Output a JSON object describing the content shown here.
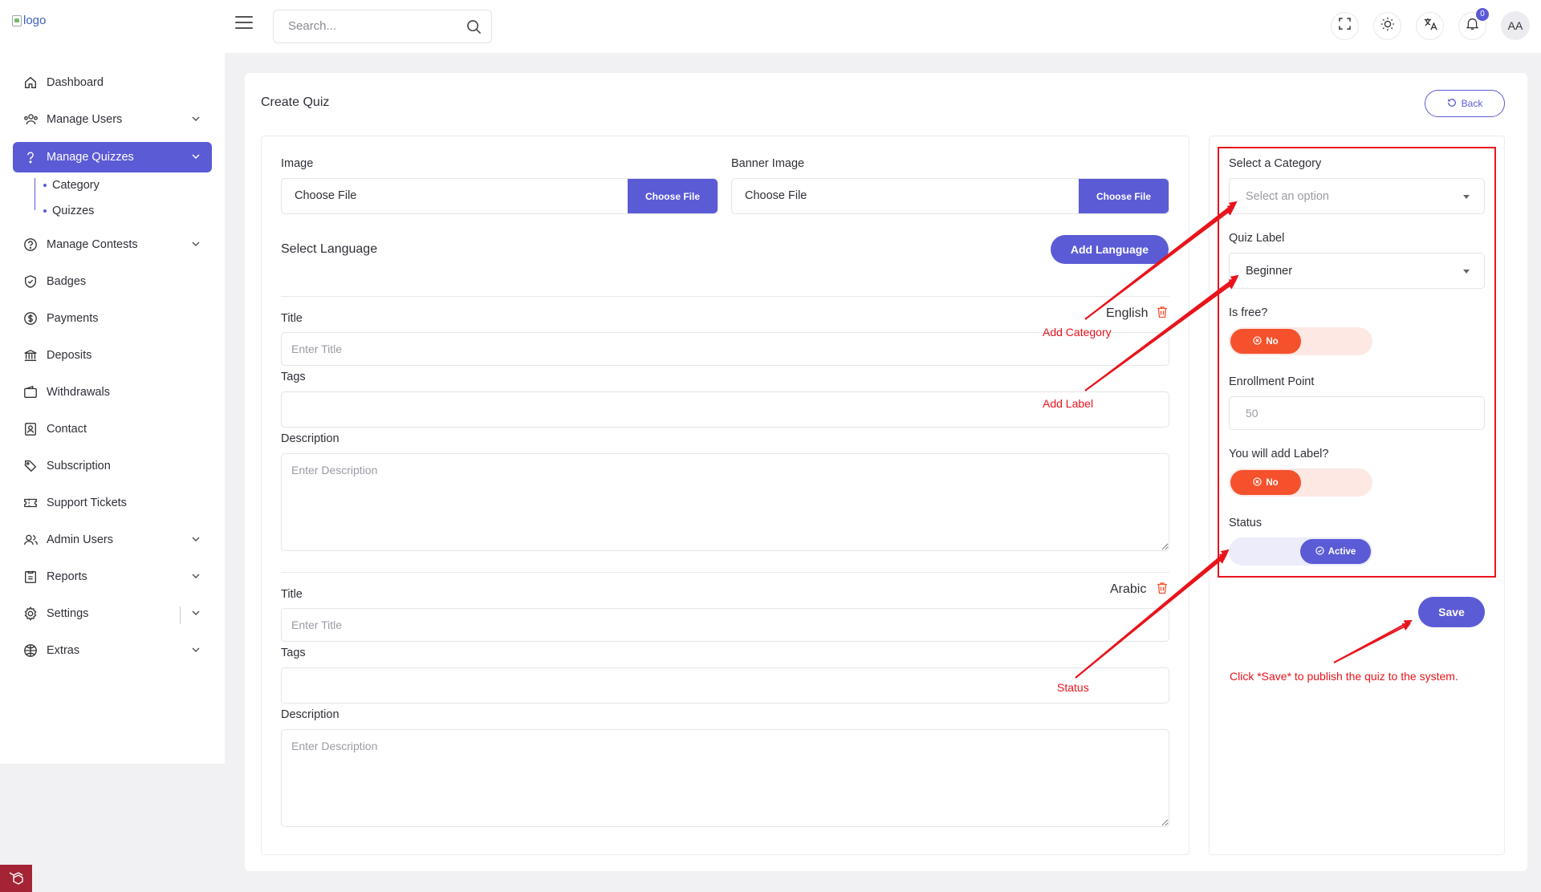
{
  "header": {
    "logo_alt": "logo",
    "search_placeholder": "Search...",
    "notification_count": "0",
    "avatar_initials": "AA"
  },
  "sidebar": {
    "items": [
      {
        "label": "Dashboard",
        "icon": "home-icon"
      },
      {
        "label": "Manage Users",
        "icon": "users-icon"
      },
      {
        "label": "Manage Quizzes",
        "icon": "question-icon"
      },
      {
        "label": "Manage Contests",
        "icon": "contest-icon"
      },
      {
        "label": "Badges",
        "icon": "shield-check-icon"
      },
      {
        "label": "Payments",
        "icon": "dollar-icon"
      },
      {
        "label": "Deposits",
        "icon": "bank-icon"
      },
      {
        "label": "Withdrawals",
        "icon": "wallet-icon"
      },
      {
        "label": "Contact",
        "icon": "contact-icon"
      },
      {
        "label": "Subscription",
        "icon": "tag-icon"
      },
      {
        "label": "Support Tickets",
        "icon": "ticket-icon"
      },
      {
        "label": "Admin Users",
        "icon": "admin-users-icon"
      },
      {
        "label": "Reports",
        "icon": "report-icon"
      },
      {
        "label": "Settings",
        "icon": "gear-icon"
      },
      {
        "label": "Extras",
        "icon": "extras-icon"
      }
    ],
    "quiz_sub_items": [
      "Category",
      "Quizzes"
    ]
  },
  "page": {
    "title": "Create Quiz",
    "back_label": "Back"
  },
  "form": {
    "image_label": "Image",
    "banner_label": "Banner Image",
    "file_text": "Choose File",
    "file_button": "Choose File",
    "select_language": "Select Language",
    "add_language": "Add Language",
    "languages": [
      {
        "name": "English",
        "title_label": "Title",
        "title_placeholder": "Enter Title",
        "tags_label": "Tags",
        "description_label": "Description",
        "description_placeholder": "Enter Description"
      },
      {
        "name": "Arabic",
        "title_label": "Title",
        "title_placeholder": "Enter Title",
        "tags_label": "Tags",
        "description_label": "Description",
        "description_placeholder": "Enter Description"
      }
    ]
  },
  "settings_panel": {
    "category_label": "Select a Category",
    "category_placeholder": "Select an option",
    "quiz_label_label": "Quiz Label",
    "quiz_label_value": "Beginner",
    "is_free_label": "Is free?",
    "is_free_value": "No",
    "enrollment_label": "Enrollment Point",
    "enrollment_placeholder": "50",
    "add_label_label": "You will add Label?",
    "add_label_value": "No",
    "status_label": "Status",
    "status_value": "Active",
    "save_label": "Save"
  },
  "annotations": {
    "add_category": "Add Category",
    "add_label": "Add Label",
    "status": "Status",
    "save_hint": "Click *Save* to publish the quiz to the system."
  },
  "colors": {
    "accent": "#5b5bd6",
    "danger": "#f4512c",
    "annotation": "#e8141c"
  }
}
